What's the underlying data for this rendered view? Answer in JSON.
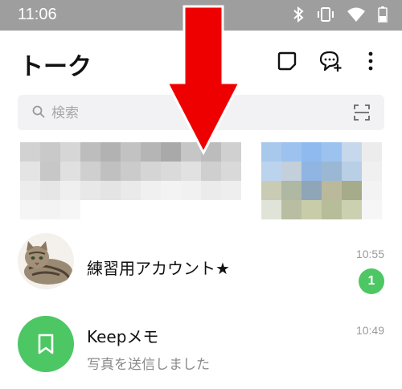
{
  "status_bar": {
    "time": "11:06",
    "icons": [
      "bluetooth-icon",
      "vibrate-icon",
      "wifi-icon",
      "battery-icon"
    ],
    "background": "#9e9e9e"
  },
  "header": {
    "title": "トーク",
    "actions": [
      "edit-chat-icon",
      "new-chat-icon",
      "more-icon"
    ]
  },
  "search": {
    "placeholder": "検索",
    "icon": "search-icon",
    "scan_icon": "scan-icon"
  },
  "chats": [
    {
      "name": "練習用アカウント★",
      "time": "10:55",
      "unread": "1",
      "avatar": "cat-photo"
    },
    {
      "name": "Keepメモ",
      "time": "10:49",
      "preview": "写真を送信しました",
      "avatar": "bookmark-icon"
    }
  ],
  "colors": {
    "accent": "#4cc764",
    "arrow": "#ee0000"
  }
}
